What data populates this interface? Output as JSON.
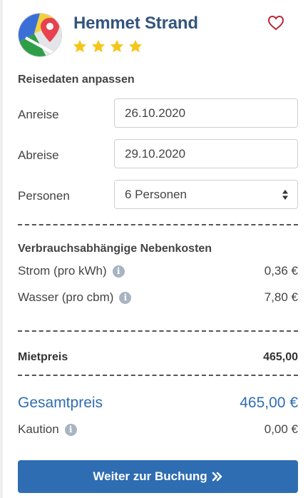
{
  "header": {
    "title": "Hemmet Strand",
    "rating_stars": 4
  },
  "travel": {
    "section_title": "Reisedaten anpassen",
    "arrival_label": "Anreise",
    "arrival_value": "26.10.2020",
    "departure_label": "Abreise",
    "departure_value": "29.10.2020",
    "persons_label": "Personen",
    "persons_value": "6 Personen"
  },
  "costs": {
    "section_title": "Verbrauchsabhängige Nebenkosten",
    "items": [
      {
        "label": "Strom (pro kWh)",
        "value": "0,36 €"
      },
      {
        "label": "Wasser (pro cbm)",
        "value": "7,80 €"
      }
    ]
  },
  "rent": {
    "label": "Mietpreis",
    "value": "465,00"
  },
  "total": {
    "label": "Gesamtpreis",
    "value": "465,00 €"
  },
  "deposit": {
    "label": "Kaution",
    "value": "0,00 €"
  },
  "cta": {
    "label": "Weiter zur Buchung"
  },
  "colors": {
    "brand_blue": "#2f6db3",
    "title_blue": "#34557d",
    "star_yellow": "#f5c518",
    "heart_red": "#b5283a"
  },
  "icons": {
    "logo": "map-pin-icon",
    "favorite": "heart-outline-icon",
    "info": "info-circle-icon",
    "select": "sort-arrows-icon",
    "cta": "double-chevron-right-icon"
  }
}
